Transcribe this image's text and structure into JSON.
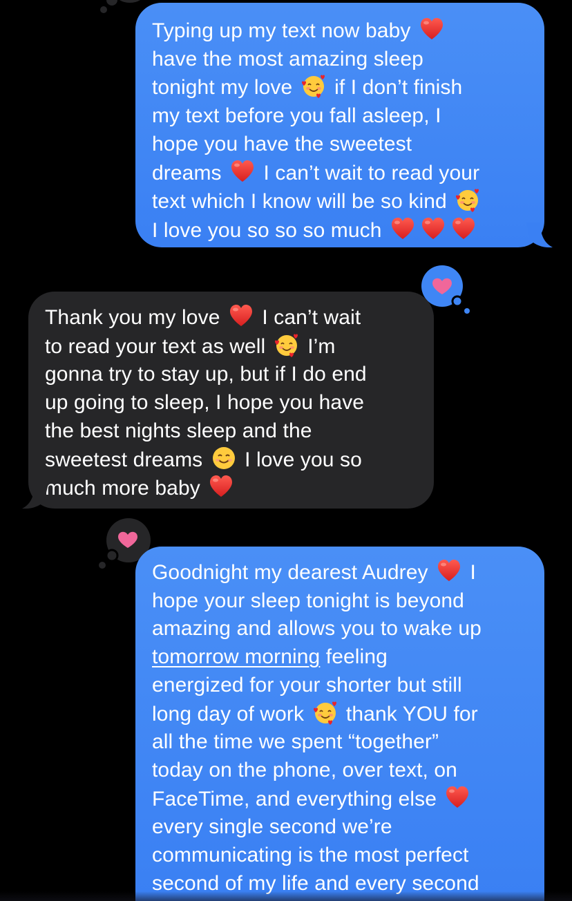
{
  "colors": {
    "background": "#000000",
    "sent_bubble": "#3f86f5",
    "received_bubble": "#262628",
    "tapback_heart": "#f0679a"
  },
  "messages": [
    {
      "direction": "sent",
      "tapback": "heart",
      "lines": [
        [
          {
            "t": "Typing up my text now baby "
          },
          {
            "e": "red-heart"
          }
        ],
        [
          {
            "t": "have the most amazing sleep"
          }
        ],
        [
          {
            "t": "tonight my love "
          },
          {
            "e": "smiling-face-with-hearts"
          },
          {
            "t": " if I don’t finish"
          }
        ],
        [
          {
            "t": "my text before you fall asleep, I"
          }
        ],
        [
          {
            "t": "hope you have the sweetest"
          }
        ],
        [
          {
            "t": "dreams "
          },
          {
            "e": "red-heart"
          },
          {
            "t": " I can’t wait to read your"
          }
        ],
        [
          {
            "t": "text which I know will be so kind "
          },
          {
            "e": "smiling-face-with-hearts"
          }
        ],
        [
          {
            "t": "I love you so so so much "
          },
          {
            "e": "red-heart"
          },
          {
            "e": "red-heart"
          },
          {
            "e": "red-heart"
          }
        ]
      ]
    },
    {
      "direction": "received",
      "tapback": "heart",
      "lines": [
        [
          {
            "t": "Thank you my love "
          },
          {
            "e": "red-heart"
          },
          {
            "t": " I can’t wait"
          }
        ],
        [
          {
            "t": "to read your text as well "
          },
          {
            "e": "smiling-face-with-hearts"
          },
          {
            "t": " I’m"
          }
        ],
        [
          {
            "t": "gonna try to stay up, but if I do end"
          }
        ],
        [
          {
            "t": "up going to sleep, I hope you have"
          }
        ],
        [
          {
            "t": "the best nights sleep and the"
          }
        ],
        [
          {
            "t": "sweetest dreams "
          },
          {
            "e": "smiling-face"
          },
          {
            "t": " I love you so"
          }
        ],
        [
          {
            "t": "much more baby "
          },
          {
            "e": "red-heart"
          }
        ]
      ]
    },
    {
      "direction": "sent",
      "tapback": "heart",
      "lines": [
        [
          {
            "t": "Goodnight my dearest Audrey "
          },
          {
            "e": "red-heart"
          },
          {
            "t": " I"
          }
        ],
        [
          {
            "t": "hope your sleep tonight is beyond"
          }
        ],
        [
          {
            "t": "amazing and allows you to wake up"
          }
        ],
        [
          {
            "l": "tomorrow morning"
          },
          {
            "t": " feeling"
          }
        ],
        [
          {
            "t": "energized for your shorter but still"
          }
        ],
        [
          {
            "t": "long day of work "
          },
          {
            "e": "smiling-face-with-hearts"
          },
          {
            "t": " thank YOU for"
          }
        ],
        [
          {
            "t": "all the time we spent “together”"
          }
        ],
        [
          {
            "t": "today on the phone, over text, on"
          }
        ],
        [
          {
            "t": "FaceTime, and everything else "
          },
          {
            "e": "red-heart"
          }
        ],
        [
          {
            "t": "every single second we’re"
          }
        ],
        [
          {
            "t": "communicating is the most perfect"
          }
        ],
        [
          {
            "t": "second of my life and every second"
          }
        ]
      ]
    }
  ]
}
